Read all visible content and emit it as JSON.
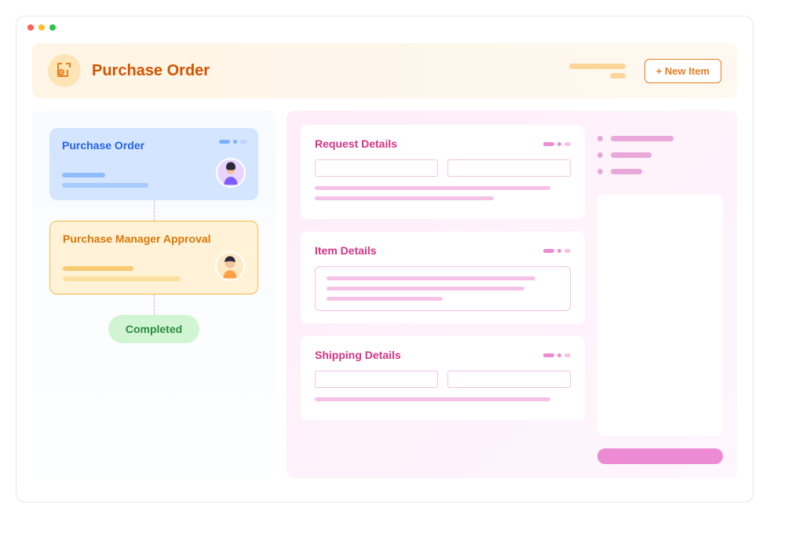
{
  "header": {
    "title": "Purchase Order",
    "new_item_label": "+ New Item"
  },
  "workflow": {
    "step1": {
      "title": "Purchase Order"
    },
    "step2": {
      "title": "Purchase Manager Approval"
    },
    "completed_label": "Completed"
  },
  "details": {
    "request": {
      "title": "Request Details"
    },
    "item": {
      "title": "Item Details"
    },
    "shipping": {
      "title": "Shipping Details"
    }
  },
  "colors": {
    "accent_orange": "#e67e22",
    "accent_blue": "#2563eb",
    "accent_pink": "#d63384",
    "completed_green": "#2d8a3e"
  }
}
